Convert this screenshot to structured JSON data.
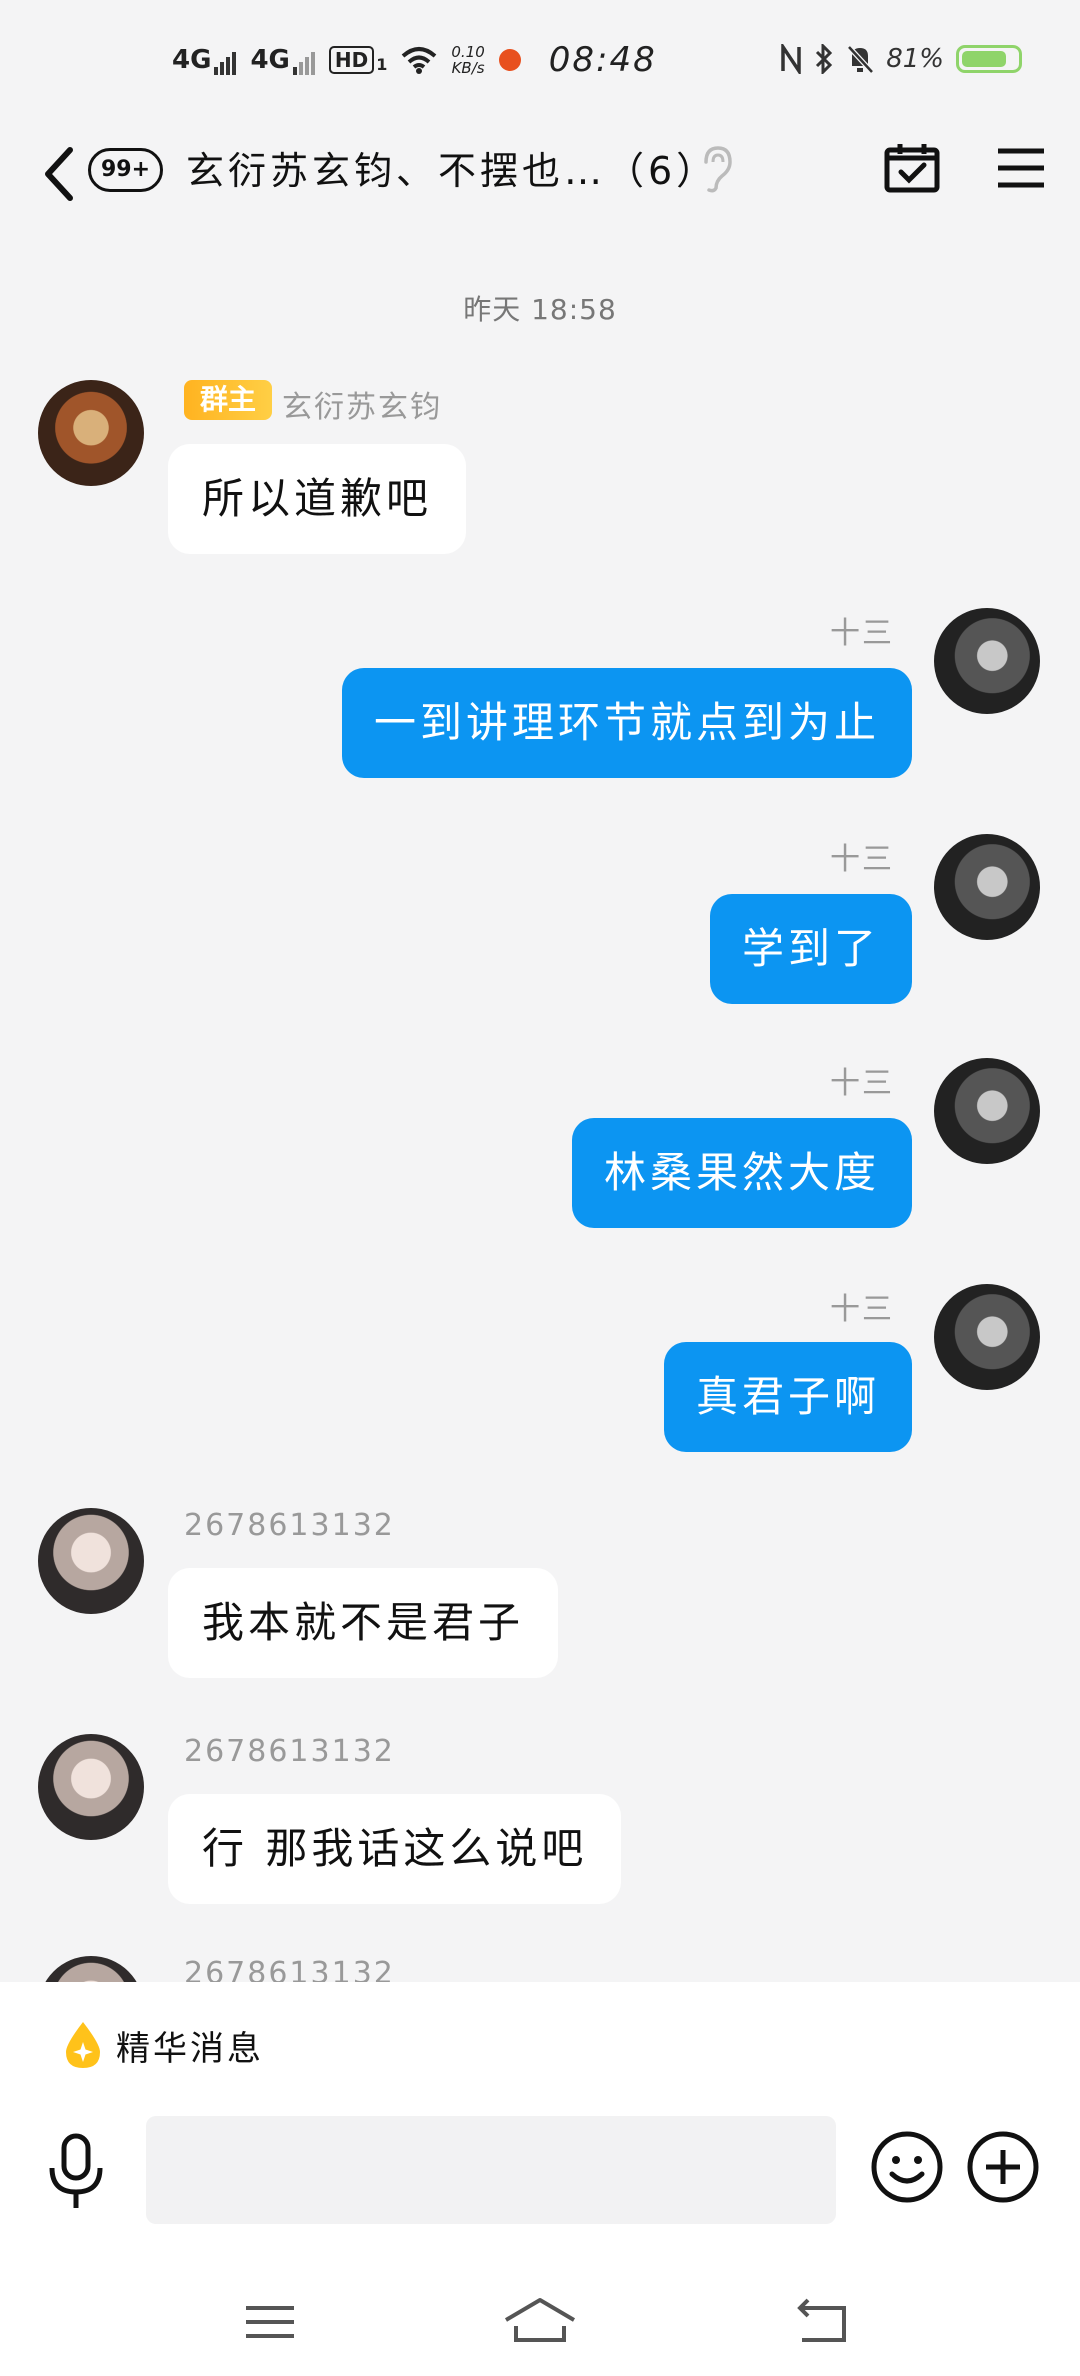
{
  "status_bar": {
    "signal1": "4G",
    "signal2": "4G",
    "hd": "HD",
    "hd_sub": "1",
    "net_speed": "0.10",
    "net_unit": "KB/s",
    "time": "08:48",
    "battery": "81%",
    "battery_level": 0.81
  },
  "header": {
    "unread_badge": "99+",
    "title": "玄衍苏玄钧、不摆也…（6）"
  },
  "chat": {
    "date_divider": "昨天 18:58",
    "owner_tag": "群主",
    "messages": [
      {
        "sender": "玄衍苏玄钧",
        "text": "所以道歉吧",
        "side": "left"
      },
      {
        "sender": "十三",
        "text": "一到讲理环节就点到为止",
        "side": "right"
      },
      {
        "sender": "十三",
        "text": "学到了",
        "side": "right"
      },
      {
        "sender": "十三",
        "text": "林桑果然大度",
        "side": "right"
      },
      {
        "sender": "十三",
        "text": "真君子啊",
        "side": "right"
      },
      {
        "sender": "2678613132",
        "text": "我本就不是君子",
        "side": "left"
      },
      {
        "sender": "2678613132",
        "text": "行 那我话这么说吧",
        "side": "left"
      }
    ],
    "partial_sender": "2678613132"
  },
  "bottom": {
    "essence_label": "精华消息",
    "input_placeholder": ""
  },
  "colors": {
    "outgoing_bubble": "#0c95f2",
    "incoming_bubble": "#ffffff",
    "background": "#f4f4f5",
    "owner_tag": "#ffb320"
  }
}
